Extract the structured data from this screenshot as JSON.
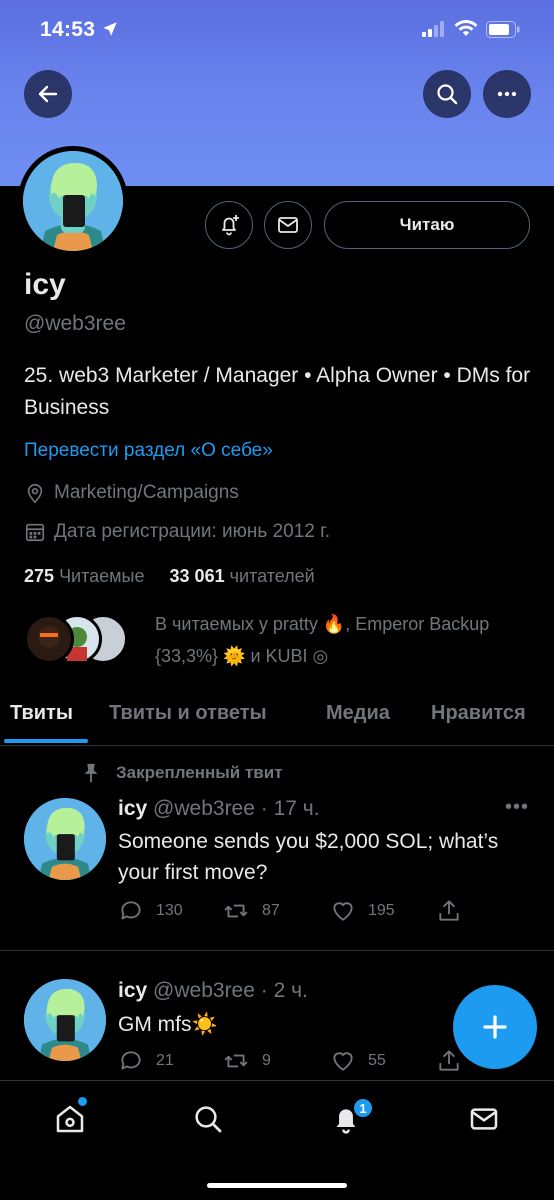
{
  "status_bar": {
    "time": "14:53"
  },
  "profile": {
    "name": "icy",
    "handle": "@web3ree",
    "follow_button": "Читаю",
    "bio": "25. web3 Marketer / Manager • Alpha Owner • DMs for Business",
    "translate_link": "Перевести раздел «О себе»",
    "category": "Marketing/Campaigns",
    "joined": "Дата регистрации: июнь 2012 г.",
    "following_count": "275",
    "following_label": "Читаемые",
    "followers_count": "33 061",
    "followers_label": "читателей",
    "followed_by": "В читаемых у pratty 🔥, Emperor Backup {33,3%} 🌞 и KUBI ◎"
  },
  "tabs": [
    "Твиты",
    "Твиты и ответы",
    "Медиа",
    "Нравится"
  ],
  "pinned_label": "Закрепленный твит",
  "tweets": [
    {
      "name": "icy",
      "handle": "@web3ree",
      "time": "· 17 ч.",
      "text": "Someone sends you $2,000 SOL; what’s your first move?",
      "replies": "130",
      "retweets": "87",
      "likes": "195"
    },
    {
      "name": "icy",
      "handle": "@web3ree",
      "time": "· 2 ч.",
      "text": "GM mfs☀️",
      "replies": "21",
      "retweets": "9",
      "likes": "55"
    }
  ],
  "nav": {
    "notifications_badge": "1"
  },
  "colors": {
    "accent": "#1d9bf0",
    "banner": "#6a85ee",
    "background": "#000000",
    "muted": "#71767b"
  },
  "icons": [
    "back-arrow-icon",
    "search-icon",
    "more-icon",
    "bell-plus-icon",
    "mail-icon",
    "location-icon",
    "calendar-icon",
    "pin-icon",
    "reply-icon",
    "retweet-icon",
    "like-icon",
    "share-icon",
    "compose-plus-icon",
    "home-icon",
    "notifications-icon",
    "messages-icon"
  ]
}
